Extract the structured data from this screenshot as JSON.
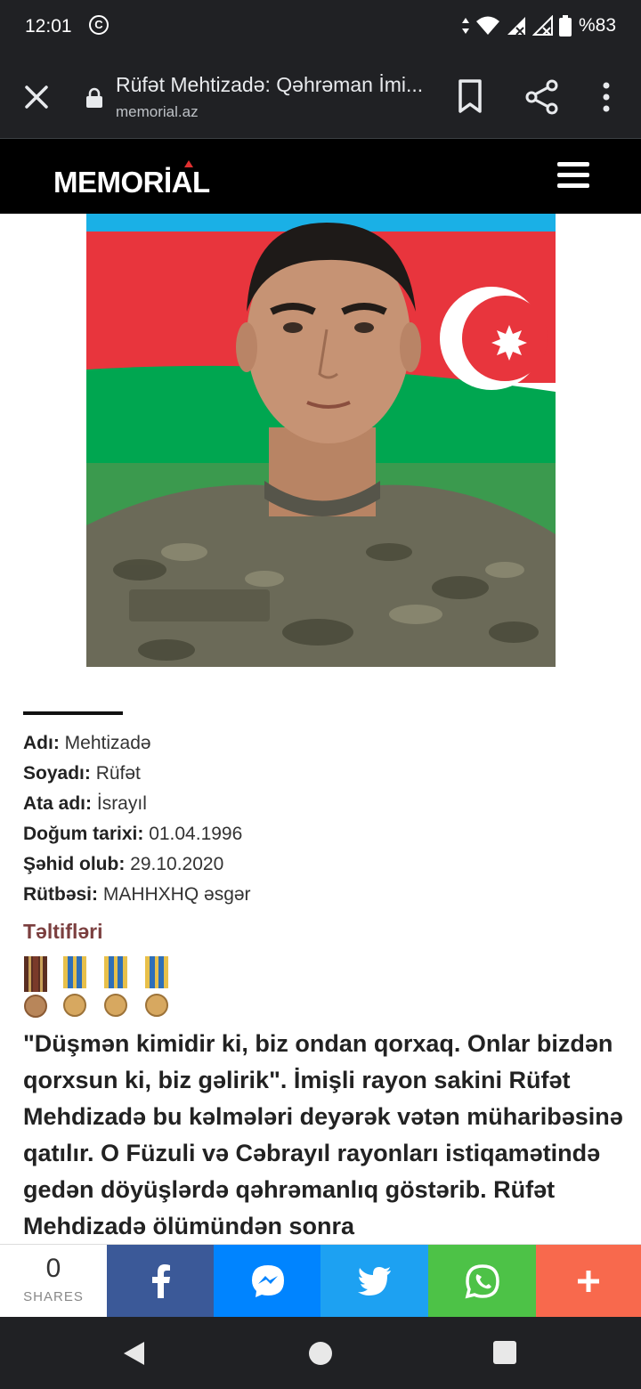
{
  "status_bar": {
    "time": "12:01",
    "c_icon": "C",
    "battery": "%83",
    "icons": [
      "data-arrows-icon",
      "wifi-icon",
      "signal-icon",
      "signal-icon",
      "battery-icon"
    ]
  },
  "browser": {
    "title": "Rüfət Mehtizadə: Qəhrəman İmi...",
    "url": "memorial.az"
  },
  "site": {
    "logo": "MEMORİAL",
    "photo_alt": "Rüfət Mehtizadə"
  },
  "profile": {
    "rows": [
      {
        "label": "Adı:",
        "value": "Mehtizadə"
      },
      {
        "label": "Soyadı:",
        "value": "Rüfət"
      },
      {
        "label": "Ata adı:",
        "value": "İsrayıl"
      },
      {
        "label": "Doğum tarixi:",
        "value": "01.04.1996"
      },
      {
        "label": "Şəhid olub:",
        "value": "29.10.2020"
      },
      {
        "label": "Rütbəsi:",
        "value": "MAHHXHQ əsgər"
      }
    ],
    "awards_title": "Təltifləri"
  },
  "article": {
    "text": "\"Düşmən kimidir ki, biz ondan qorxaq. Onlar bizdən qorxsun ki, biz gəlirik\". İmişli rayon sakini Rüfət Mehdizadə bu kəlmələri deyərək vətən müharibəsinə qatılır. O Füzuli və Cəbrayıl rayonları istiqamətində gedən döyüşlərdə qəhrəmanlıq göstərib. Rüfət Mehdizadə ölümündən sonra"
  },
  "share": {
    "count": "0",
    "label": "SHARES",
    "colors": {
      "facebook": "#3b5998",
      "messenger": "#0084ff",
      "twitter": "#1da1f2",
      "whatsapp": "#4dc247",
      "more": "#f8694d"
    }
  }
}
